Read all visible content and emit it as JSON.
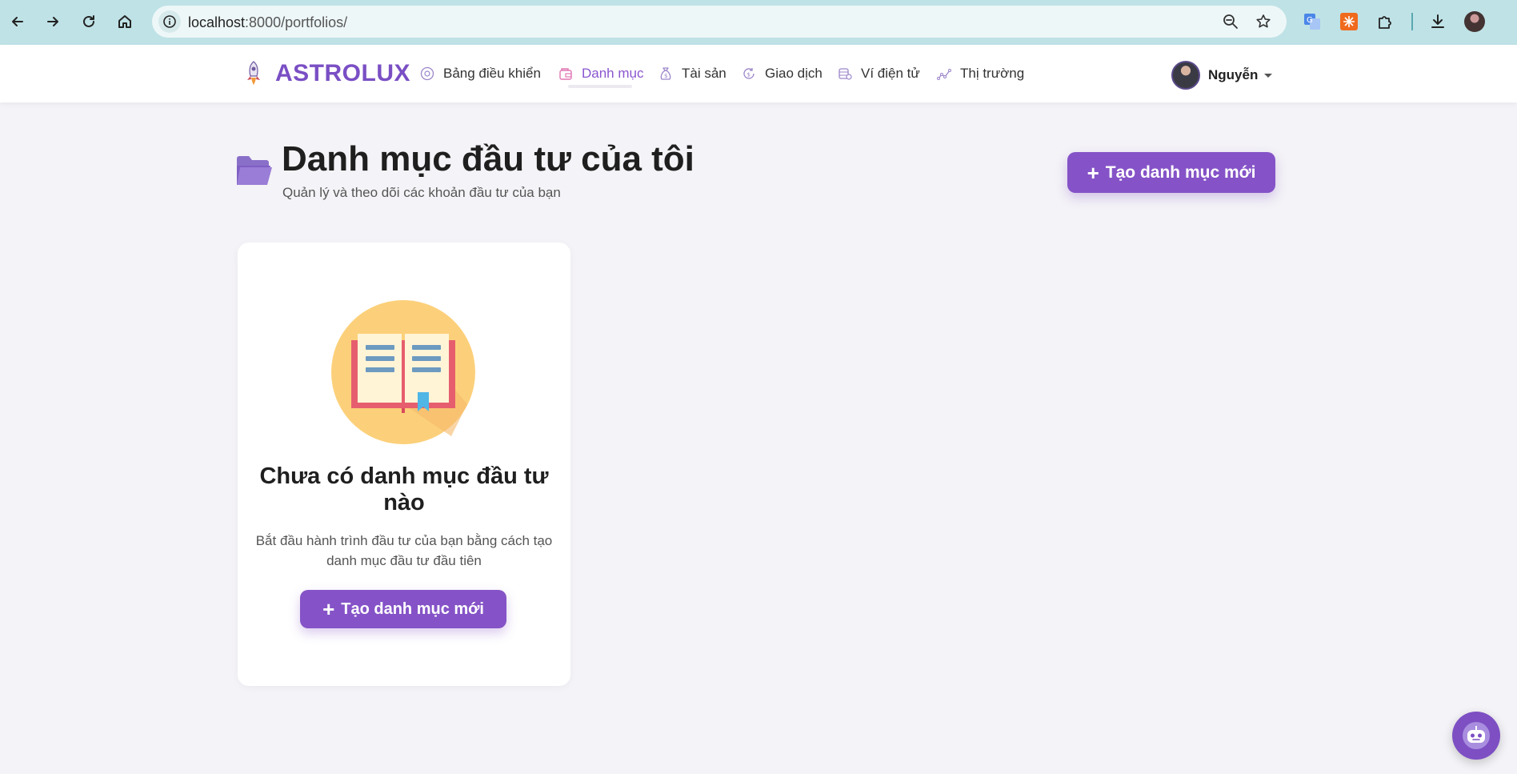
{
  "browser": {
    "url_host": "localhost",
    "url_path": ":8000/portfolios/"
  },
  "site": {
    "brand": "ASTROLUX",
    "nav": [
      {
        "label": "Bảng điều khiển",
        "icon": "dashboard-icon"
      },
      {
        "label": "Danh mục",
        "icon": "portfolio-icon",
        "active": true
      },
      {
        "label": "Tài sản",
        "icon": "money-bag-icon"
      },
      {
        "label": "Giao dịch",
        "icon": "transaction-icon"
      },
      {
        "label": "Ví điện tử",
        "icon": "wallet-icon"
      },
      {
        "label": "Thị trường",
        "icon": "market-chart-icon"
      }
    ],
    "user": {
      "name": "Nguyễn"
    }
  },
  "page": {
    "title": "Danh mục đầu tư của tôi",
    "subtitle": "Quản lý và theo dõi các khoản đầu tư của bạn",
    "create_button": "Tạo danh mục mới"
  },
  "empty_state": {
    "title": "Chưa có danh mục đầu tư nào",
    "description": "Bắt đầu hành trình đầu tư của bạn bằng cách tạo danh mục đầu tư đầu tiên",
    "button": "Tạo danh mục mới"
  },
  "colors": {
    "accent": "#8553c7",
    "brand": "#7a4fc4",
    "browser_bar": "#bfe2e6",
    "page_bg": "#f4f3f7"
  }
}
